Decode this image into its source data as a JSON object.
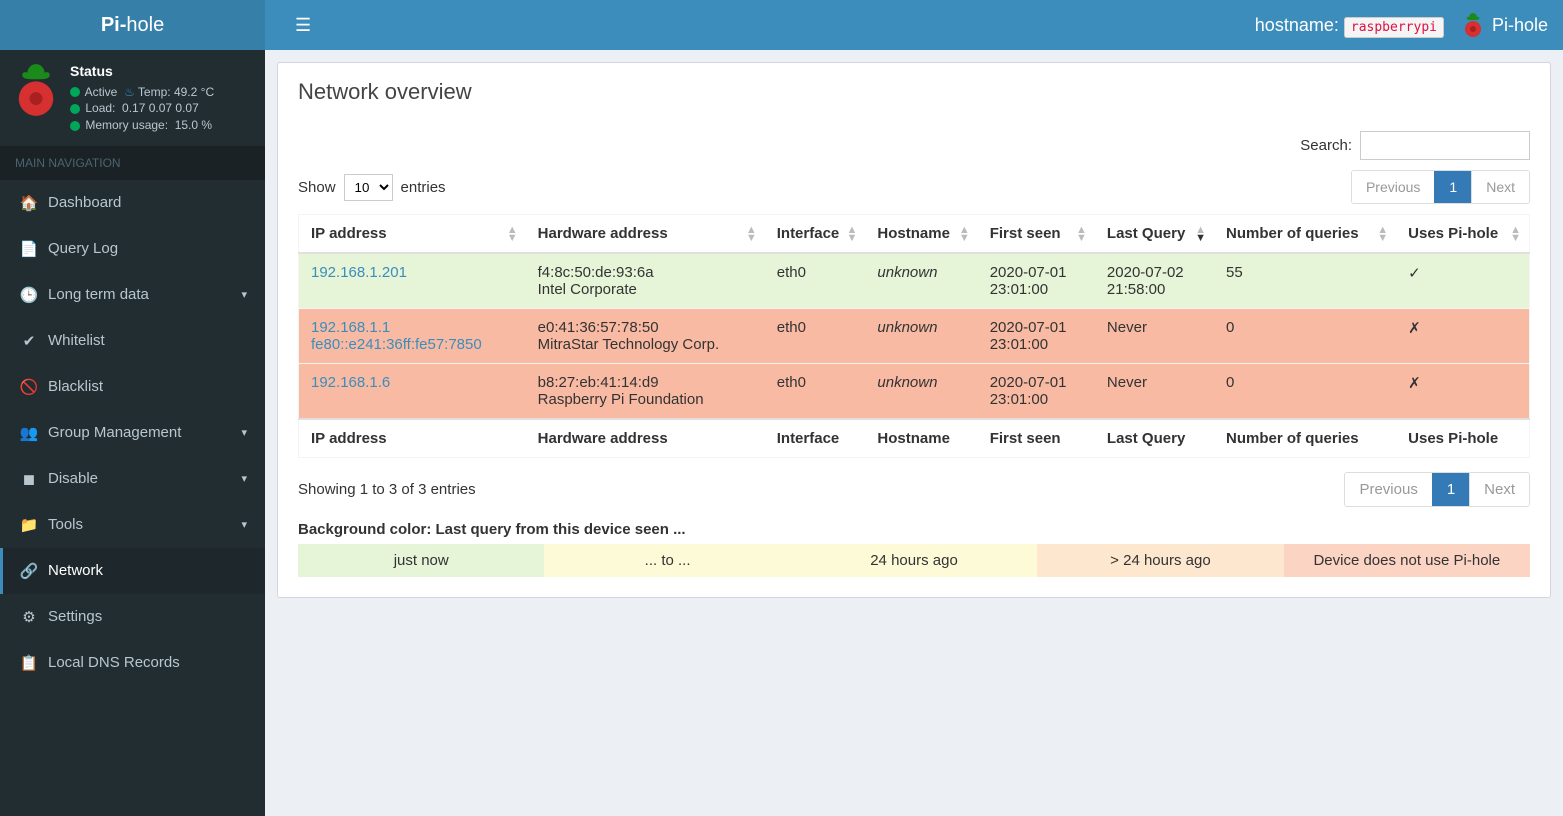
{
  "header": {
    "logo_prefix": "Pi-",
    "logo_suffix": "hole",
    "hostname_label": "hostname:",
    "hostname_value": "raspberrypi",
    "brand_text": "Pi-hole"
  },
  "status": {
    "title": "Status",
    "active": "Active",
    "temp_label": "Temp:",
    "temp_value": "49.2 °C",
    "load_label": "Load:",
    "load_value": "0.17  0.07  0.07",
    "mem_label": "Memory usage:",
    "mem_value": "15.0 %"
  },
  "nav": {
    "header": "MAIN NAVIGATION",
    "items": [
      {
        "label": "Dashboard",
        "icon": "home",
        "expandable": false
      },
      {
        "label": "Query Log",
        "icon": "file",
        "expandable": false
      },
      {
        "label": "Long term data",
        "icon": "clock",
        "expandable": true
      },
      {
        "label": "Whitelist",
        "icon": "check",
        "expandable": false
      },
      {
        "label": "Blacklist",
        "icon": "ban",
        "expandable": false
      },
      {
        "label": "Group Management",
        "icon": "users",
        "expandable": true
      },
      {
        "label": "Disable",
        "icon": "stop",
        "expandable": true
      },
      {
        "label": "Tools",
        "icon": "folder",
        "expandable": true
      },
      {
        "label": "Network",
        "icon": "network",
        "expandable": false,
        "active": true
      },
      {
        "label": "Settings",
        "icon": "gear",
        "expandable": false
      },
      {
        "label": "Local DNS Records",
        "icon": "list",
        "expandable": false
      }
    ]
  },
  "page": {
    "title": "Network overview",
    "show_prefix": "Show",
    "show_suffix": "entries",
    "show_value": "10",
    "search_label": "Search:",
    "prev": "Previous",
    "next": "Next",
    "page_number": "1",
    "info": "Showing 1 to 3 of 3 entries",
    "legend_title": "Background color: Last query from this device seen ...",
    "legend": [
      "just now",
      "... to ...",
      "24 hours ago",
      "> 24 hours ago",
      "Device does not use Pi-hole"
    ]
  },
  "table": {
    "headers": [
      "IP address",
      "Hardware address",
      "Interface",
      "Hostname",
      "First seen",
      "Last Query",
      "Number of queries",
      "Uses Pi-hole"
    ],
    "rows": [
      {
        "class": "green",
        "ips": [
          "192.168.1.201"
        ],
        "hw": "f4:8c:50:de:93:6a",
        "vendor": "Intel Corporate",
        "iface": "eth0",
        "hostname": "unknown",
        "first": "2020-07-01 23:01:00",
        "last": "2020-07-02 21:58:00",
        "nq": "55",
        "uses": "✓"
      },
      {
        "class": "red",
        "ips": [
          "192.168.1.1",
          "fe80::e241:36ff:fe57:7850"
        ],
        "hw": "e0:41:36:57:78:50",
        "vendor": "MitraStar Technology Corp.",
        "iface": "eth0",
        "hostname": "unknown",
        "first": "2020-07-01 23:01:00",
        "last": "Never",
        "nq": "0",
        "uses": "✗"
      },
      {
        "class": "red",
        "ips": [
          "192.168.1.6"
        ],
        "hw": "b8:27:eb:41:14:d9",
        "vendor": "Raspberry Pi Foundation",
        "iface": "eth0",
        "hostname": "unknown",
        "first": "2020-07-01 23:01:00",
        "last": "Never",
        "nq": "0",
        "uses": "✗"
      }
    ]
  }
}
